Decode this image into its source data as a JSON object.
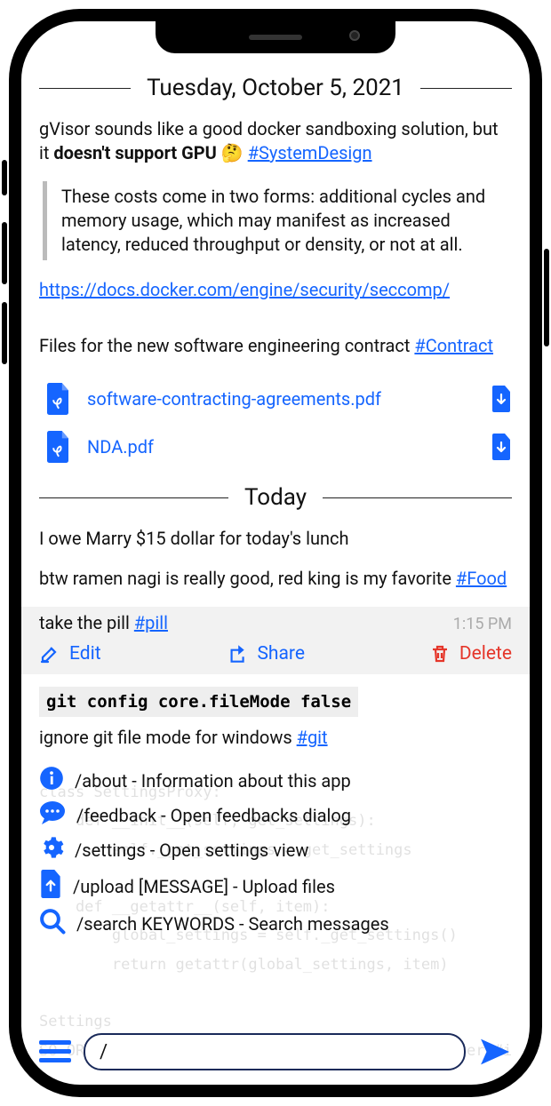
{
  "colors": {
    "accent": "#1565ff",
    "danger": "#e5362a"
  },
  "dates": {
    "previous": "Tuesday, October 5, 2021",
    "today": "Today"
  },
  "entries": {
    "gvisor": {
      "text_pre": "gVisor sounds like a good docker sandboxing solution, but it ",
      "text_bold": "doesn't support GPU",
      "emoji": "🤔",
      "hashtag": "#SystemDesign"
    },
    "quote": "These costs come in two forms: additional cycles and memory usage, which may manifest as increased latency, reduced throughput or density, or not at all.",
    "docker_link": "https://docs.docker.com/engine/security/seccomp/",
    "contract": {
      "text": "Files for the new software engineering contract ",
      "hashtag": "#Contract"
    },
    "files": [
      {
        "name": "software-contracting-agreements.pdf"
      },
      {
        "name": "NDA.pdf"
      }
    ],
    "owe": "I owe Marry $15 dollar for today's lunch",
    "ramen": {
      "text": "btw ramen nagi is really good, red king is my favorite ",
      "hashtag": "#Food"
    },
    "pill": {
      "text": "take the pill ",
      "hashtag": "#pill",
      "time": "1:15 PM"
    },
    "code": "git config core.fileMode false",
    "git_note": {
      "text": "ignore git file mode for windows ",
      "hashtag": "#git"
    }
  },
  "actions": {
    "edit": "Edit",
    "share": "Share",
    "delete": "Delete"
  },
  "commands": [
    {
      "icon": "info",
      "text": "/about - Information about this app"
    },
    {
      "icon": "chat",
      "text": "/feedback - Open feedbacks dialog"
    },
    {
      "icon": "gear",
      "text": "/settings - Open settings view"
    },
    {
      "icon": "upload",
      "text": "/upload [MESSAGE] - Upload files"
    },
    {
      "icon": "search",
      "text": "/search KEYWORDS - Search messages"
    }
  ],
  "input": {
    "value": "/"
  },
  "background_code": "class SettingsProxy:\n    def __init__(self, get_settings):\n        self._get_settings = get_settings\n\n    def __getattr__(self, item):\n        global_settings = self._get_settings()\n        return getattr(global_settings, item)\n\nSettings\nSO_ORIGINAL_DST for reading the original ip after #iptable"
}
